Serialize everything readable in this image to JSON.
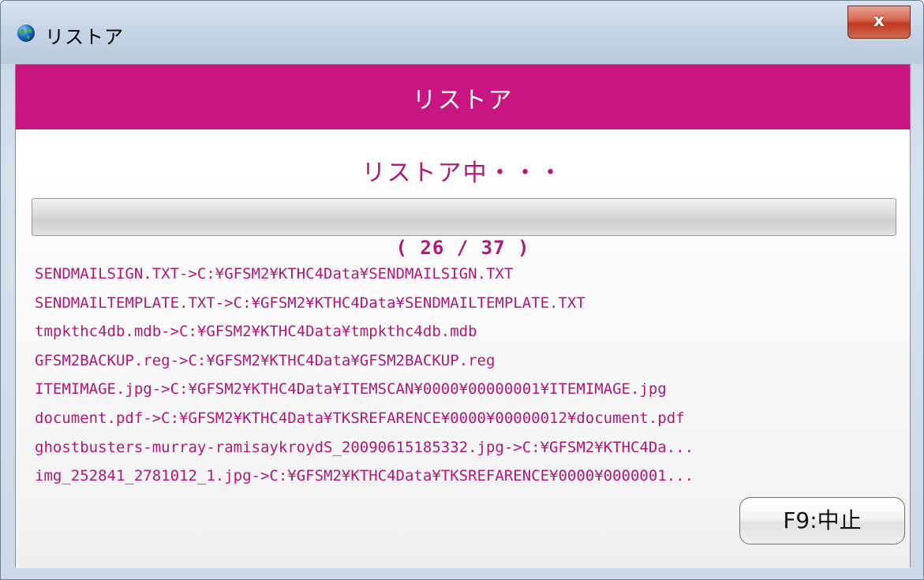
{
  "window": {
    "title": "リストア",
    "close_label": "x"
  },
  "header": {
    "title": "リストア"
  },
  "status": {
    "message": "リストア中・・・",
    "counter": "( 26 / 37 )",
    "progress_fraction": 0.0
  },
  "log": [
    "SENDMAILSIGN.TXT->C:¥GFSM2¥KTHC4Data¥SENDMAILSIGN.TXT",
    "SENDMAILTEMPLATE.TXT->C:¥GFSM2¥KTHC4Data¥SENDMAILTEMPLATE.TXT",
    "tmpkthc4db.mdb->C:¥GFSM2¥KTHC4Data¥tmpkthc4db.mdb",
    "GFSM2BACKUP.reg->C:¥GFSM2¥KTHC4Data¥GFSM2BACKUP.reg",
    "ITEMIMAGE.jpg->C:¥GFSM2¥KTHC4Data¥ITEMSCAN¥0000¥00000001¥ITEMIMAGE.jpg",
    "document.pdf->C:¥GFSM2¥KTHC4Data¥TKSREFARENCE¥0000¥00000012¥document.pdf",
    "ghostbusters-murray-ramisaykroydS_20090615185332.jpg->C:¥GFSM2¥KTHC4Da...",
    "img_252841_2781012_1.jpg->C:¥GFSM2¥KTHC4Data¥TKSREFARENCE¥0000¥0000001..."
  ],
  "buttons": {
    "stop_label": "F9:中止"
  },
  "icons": {
    "app": "globe-icon",
    "close": "close-icon"
  },
  "colors": {
    "accent": "#c8157f",
    "text_accent": "#b0187a",
    "close_red": "#c2381f"
  }
}
